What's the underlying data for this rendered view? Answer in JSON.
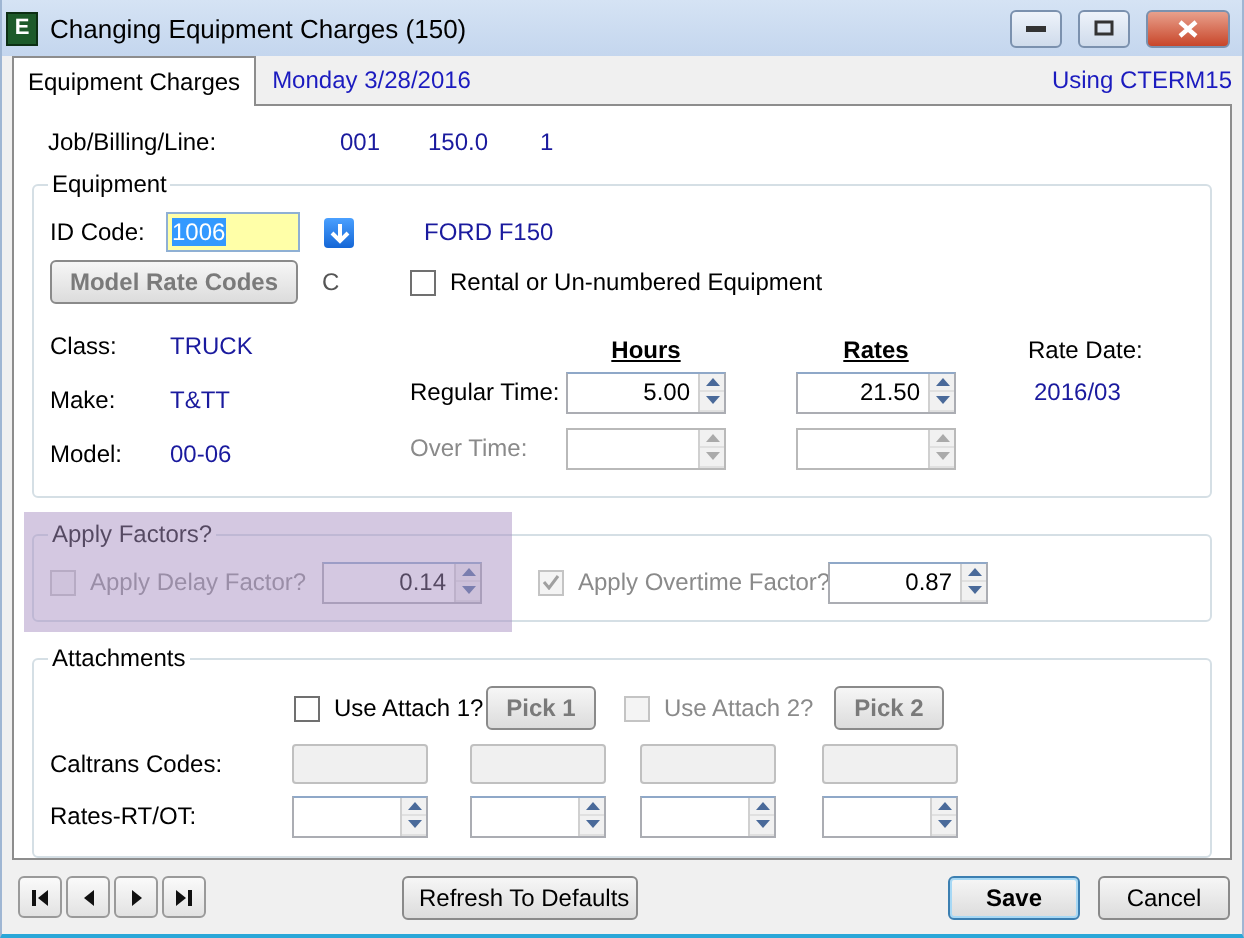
{
  "window": {
    "title": "Changing Equipment Charges  (150)",
    "icon_letter": "E"
  },
  "tabs": [
    {
      "label": "Equipment Charges",
      "selected": true
    }
  ],
  "date": "Monday  3/28/2016",
  "using": "Using CTERM15",
  "job": {
    "label": "Job/Billing/Line:",
    "values": [
      "001",
      "150.0",
      "1"
    ]
  },
  "equipment": {
    "legend": "Equipment",
    "id_label": "ID Code:",
    "id_value": "1006",
    "description": "FORD F150",
    "model_rate_button": {
      "label": "Model Rate Codes",
      "disabled": true
    },
    "code_letter": "C",
    "rental": {
      "label": "Rental or Un-numbered Equipment",
      "checked": false
    },
    "info": [
      {
        "label": "Class:",
        "value": "TRUCK"
      },
      {
        "label": "Make:",
        "value": "T&TT"
      },
      {
        "label": "Model:",
        "value": "00-06"
      }
    ],
    "hours_header": "Hours",
    "rates_header": "Rates",
    "rate_date_label": "Rate Date:",
    "rate_date": "2016/03",
    "times": [
      {
        "label": "Regular Time:",
        "hours": "5.00",
        "rate": "21.50",
        "disabled": false
      },
      {
        "label": "Over Time:",
        "disabled": true
      }
    ]
  },
  "factors": {
    "legend": "Apply Factors?",
    "highlighted": true,
    "items": [
      {
        "label": "Apply Delay Factor?",
        "checked": false,
        "disabled": true,
        "value": "0.14"
      },
      {
        "label": "Apply Overtime Factor?",
        "checked": true,
        "disabled": true,
        "value": "0.87"
      }
    ]
  },
  "attachments": {
    "legend": "Attachments",
    "items": [
      {
        "label": "Use Attach 1?",
        "checked": false,
        "disabled": false,
        "button": "Pick 1"
      },
      {
        "label": "Use Attach 2?",
        "checked": false,
        "disabled": true,
        "button": "Pick 2"
      }
    ],
    "caltrans_label": "Caltrans Codes:",
    "rates_label": "Rates-RT/OT:"
  },
  "buttons": [
    {
      "label": "Refresh To Defaults",
      "default": false
    },
    {
      "label": "Save",
      "default": true
    },
    {
      "label": "Cancel",
      "default": false
    }
  ]
}
